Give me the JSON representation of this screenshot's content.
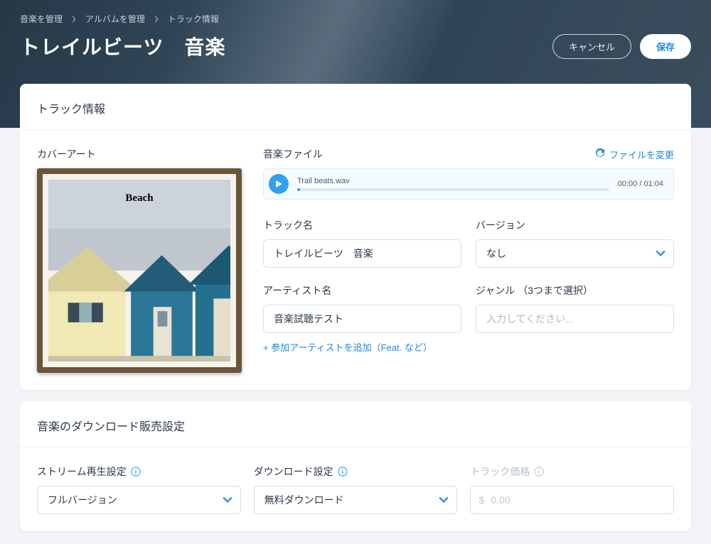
{
  "breadcrumbs": {
    "items": [
      "音楽を管理",
      "アルバムを管理",
      "トラック情報"
    ]
  },
  "page_title": "トレイルビーツ　音楽",
  "actions": {
    "cancel": "キャンセル",
    "save": "保存"
  },
  "track_info": {
    "section_title": "トラック情報",
    "cover_label": "カバーアート",
    "cover_caption": "Beach",
    "file_label": "音楽ファイル",
    "change_file": "ファイルを変更",
    "player": {
      "filename": "Trail beats.wav",
      "time": "00:00 / 01:04"
    },
    "track_name_label": "トラック名",
    "track_name_value": "トレイルビーツ　音楽",
    "version_label": "バージョン",
    "version_value": "なし",
    "artist_label": "アーティスト名",
    "artist_value": "音楽試聴テスト",
    "add_artist": "+ 参加アーティストを追加（Feat. など）",
    "genre_label": "ジャンル （3つまで選択）",
    "genre_placeholder": "入力してください..."
  },
  "sales": {
    "section_title": "音楽のダウンロード販売設定",
    "stream_label": "ストリーム再生設定",
    "stream_value": "フルバージョン",
    "download_label": "ダウンロード設定",
    "download_value": "無料ダウンロード",
    "price_label": "トラック価格",
    "price_value": "0.00",
    "currency": "$"
  }
}
